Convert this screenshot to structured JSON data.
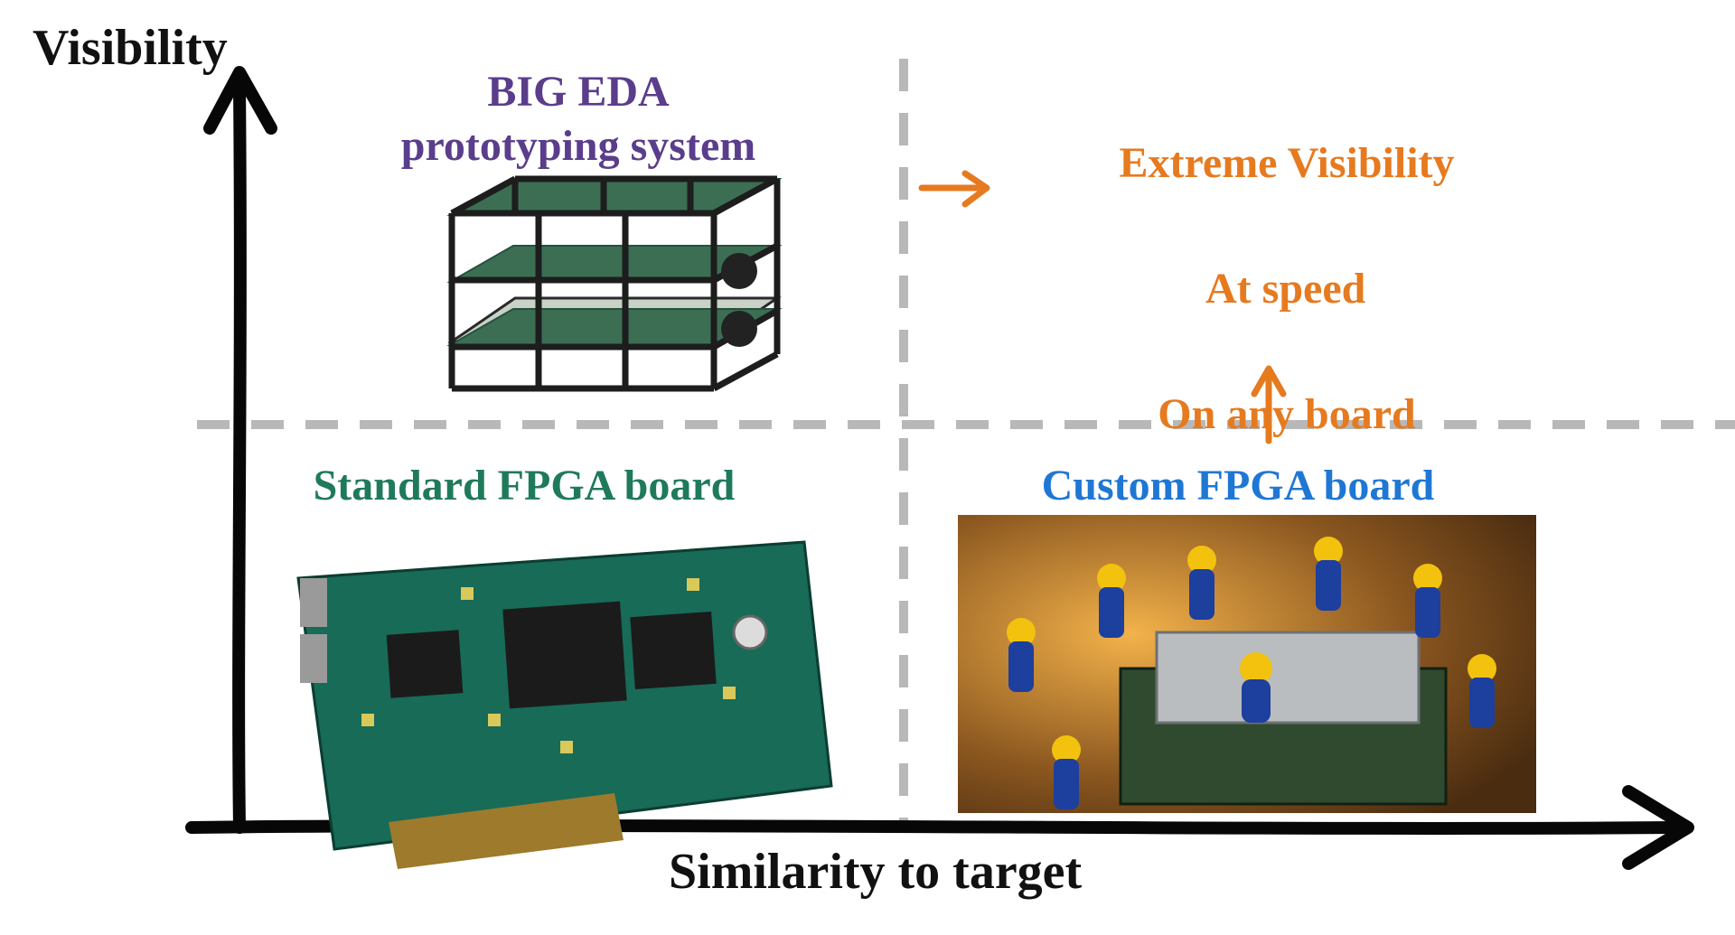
{
  "chart_data": {
    "type": "scatter",
    "xlabel": "Similarity to target",
    "ylabel": "Visibility",
    "xlim": [
      0,
      10
    ],
    "ylim": [
      0,
      10
    ],
    "series": [
      {
        "name": "BIG EDA prototyping system",
        "x": [
          3
        ],
        "y": [
          7
        ],
        "color": "#5a3d8b"
      },
      {
        "name": "Standard FPGA board",
        "x": [
          3
        ],
        "y": [
          3
        ],
        "color": "#1f7a5b"
      },
      {
        "name": "Custom FPGA board",
        "x": [
          7
        ],
        "y": [
          3
        ],
        "color": "#1f77d4"
      },
      {
        "name": "Extreme Visibility / At speed / On any board",
        "x": [
          7
        ],
        "y": [
          7
        ],
        "color": "#e67a1f"
      }
    ]
  },
  "axis_y_label": "Visibility",
  "axis_x_label": "Similarity to target",
  "quadrants": {
    "top_left_label": "BIG EDA\nprototyping system",
    "bottom_left_label": "Standard FPGA board",
    "bottom_right_label": "Custom FPGA board",
    "goal_line1": "Extreme Visibility",
    "goal_line2": "At speed",
    "goal_line3": "On any board"
  },
  "colors": {
    "axis": "#070707",
    "purple": "#5a3d8b",
    "green": "#1f7a5b",
    "blue": "#1f77d4",
    "orange": "#e67a1f",
    "dash": "#b8b8b8"
  }
}
